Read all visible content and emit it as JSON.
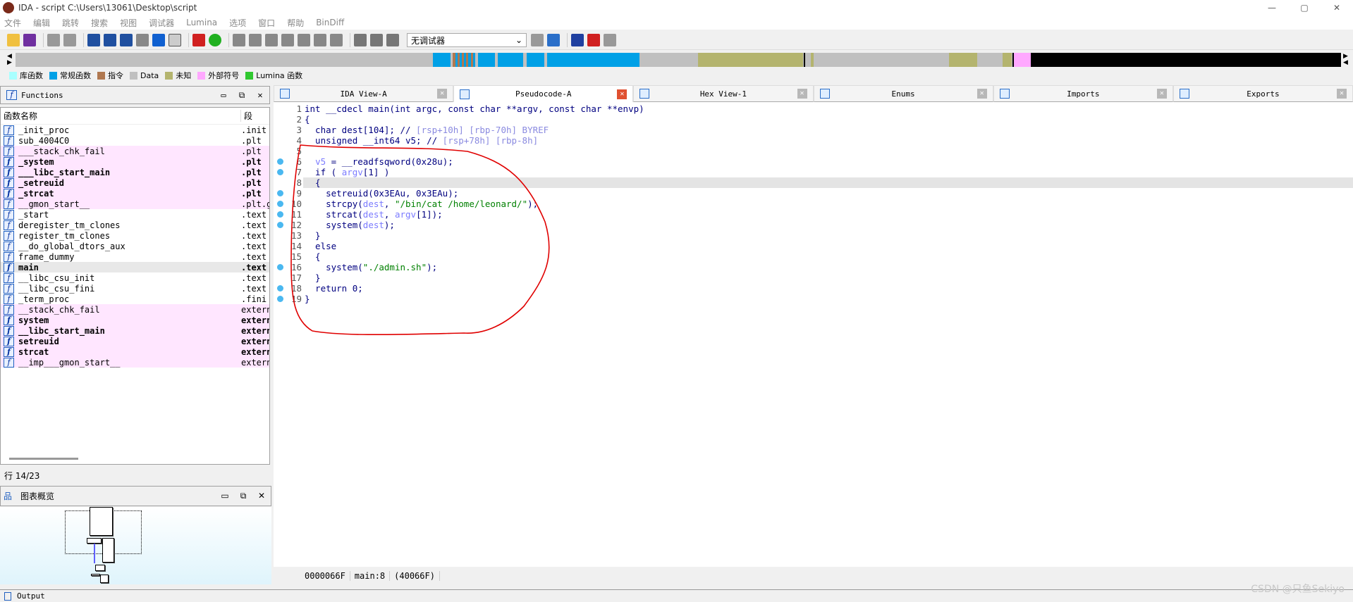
{
  "window": {
    "title": "IDA - script C:\\Users\\13061\\Desktop\\script",
    "controls": [
      "—",
      "▢",
      "✕"
    ]
  },
  "menu": [
    "文件",
    "编辑",
    "跳转",
    "搜索",
    "视图",
    "调试器",
    "Lumina",
    "选项",
    "窗口",
    "帮助",
    "BinDiff"
  ],
  "toolbar": {
    "debugger_select": "无调试器"
  },
  "legend": [
    {
      "label": "库函数",
      "color": "#a8ffff"
    },
    {
      "label": "常规函数",
      "color": "#00a0e6"
    },
    {
      "label": "指令",
      "color": "#b07850"
    },
    {
      "label": "Data",
      "color": "#c0c0c0"
    },
    {
      "label": "未知",
      "color": "#b4b46e"
    },
    {
      "label": "外部符号",
      "color": "#ffa8ff"
    },
    {
      "label": "Lumina 函数",
      "color": "#30c830"
    }
  ],
  "functions": {
    "title": "Functions",
    "columns": [
      "函数名称",
      "段"
    ],
    "rows": [
      {
        "name": "_init_proc",
        "segment": ".init",
        "style": ""
      },
      {
        "name": "sub_4004C0",
        "segment": ".plt",
        "style": ""
      },
      {
        "name": "___stack_chk_fail",
        "segment": ".plt",
        "style": "pink"
      },
      {
        "name": "_system",
        "segment": ".plt",
        "style": "pink bold"
      },
      {
        "name": "___libc_start_main",
        "segment": ".plt",
        "style": "pink bold"
      },
      {
        "name": "_setreuid",
        "segment": ".plt",
        "style": "pink bold"
      },
      {
        "name": "_strcat",
        "segment": ".plt",
        "style": "pink bold"
      },
      {
        "name": "__gmon_start__",
        "segment": ".plt.got",
        "style": "pink"
      },
      {
        "name": "_start",
        "segment": ".text",
        "style": ""
      },
      {
        "name": "deregister_tm_clones",
        "segment": ".text",
        "style": ""
      },
      {
        "name": "register_tm_clones",
        "segment": ".text",
        "style": ""
      },
      {
        "name": "__do_global_dtors_aux",
        "segment": ".text",
        "style": ""
      },
      {
        "name": "frame_dummy",
        "segment": ".text",
        "style": ""
      },
      {
        "name": "main",
        "segment": ".text",
        "style": "sel bold"
      },
      {
        "name": "__libc_csu_init",
        "segment": ".text",
        "style": ""
      },
      {
        "name": "__libc_csu_fini",
        "segment": ".text",
        "style": ""
      },
      {
        "name": "_term_proc",
        "segment": ".fini",
        "style": ""
      },
      {
        "name": "__stack_chk_fail",
        "segment": "extern",
        "style": "pink"
      },
      {
        "name": "system",
        "segment": "extern",
        "style": "pink bold"
      },
      {
        "name": "__libc_start_main",
        "segment": "extern",
        "style": "pink bold"
      },
      {
        "name": "setreuid",
        "segment": "extern",
        "style": "pink bold"
      },
      {
        "name": "strcat",
        "segment": "extern",
        "style": "pink bold"
      },
      {
        "name": "__imp___gmon_start__",
        "segment": "extern",
        "style": "pink"
      }
    ],
    "row_info": "行 14/23"
  },
  "graph_overview": {
    "title": "图表概览"
  },
  "tabs": [
    {
      "label": "IDA View-A",
      "active": false
    },
    {
      "label": "Pseudocode-A",
      "active": true
    },
    {
      "label": "Hex View-1",
      "active": false
    },
    {
      "label": "Enums",
      "active": false
    },
    {
      "label": "Imports",
      "active": false
    },
    {
      "label": "Exports",
      "active": false
    }
  ],
  "pseudocode": {
    "lines": [
      {
        "n": "1",
        "bp": false,
        "html": "int __cdecl main(int argc, const char **argv, const char **envp)"
      },
      {
        "n": "2",
        "bp": false,
        "html": "{"
      },
      {
        "n": "3",
        "bp": false,
        "html": "  char dest[104]; // <c>[rsp+10h] [rbp-70h] BYREF</c>"
      },
      {
        "n": "4",
        "bp": false,
        "html": "  unsigned __int64 v5; // <c>[rsp+78h] [rbp-8h]</c>"
      },
      {
        "n": "5",
        "bp": false,
        "html": ""
      },
      {
        "n": "6",
        "bp": true,
        "html": "  <v>v5</v> = __readfsqword(0x28u);"
      },
      {
        "n": "7",
        "bp": true,
        "html": "  if ( <v>argv</v>[1] )"
      },
      {
        "n": "8",
        "bp": false,
        "html": "  {",
        "hl": true
      },
      {
        "n": "9",
        "bp": true,
        "html": "    setreuid(0x3EAu, 0x3EAu);"
      },
      {
        "n": "10",
        "bp": true,
        "html": "    strcpy(<v>dest</v>, <s>\"/bin/cat /home/leonard/\"</s>);"
      },
      {
        "n": "11",
        "bp": true,
        "html": "    strcat(<v>dest</v>, <v>argv</v>[1]);"
      },
      {
        "n": "12",
        "bp": true,
        "html": "    system(<v>dest</v>);"
      },
      {
        "n": "13",
        "bp": false,
        "html": "  }"
      },
      {
        "n": "14",
        "bp": false,
        "html": "  else"
      },
      {
        "n": "15",
        "bp": false,
        "html": "  {"
      },
      {
        "n": "16",
        "bp": true,
        "html": "    system(<s>\"./admin.sh\"</s>);"
      },
      {
        "n": "17",
        "bp": false,
        "html": "  }"
      },
      {
        "n": "18",
        "bp": true,
        "html": "  return 0;"
      },
      {
        "n": "19",
        "bp": true,
        "html": "}"
      }
    ],
    "status": [
      "0000066F",
      "main:8",
      "(40066F)"
    ]
  },
  "output": {
    "title": "Output"
  },
  "watermark": "CSDN @只鱼Sekiyo",
  "colors": {
    "annotation": "#e00000",
    "breakpoint": "#4ab8f0"
  }
}
